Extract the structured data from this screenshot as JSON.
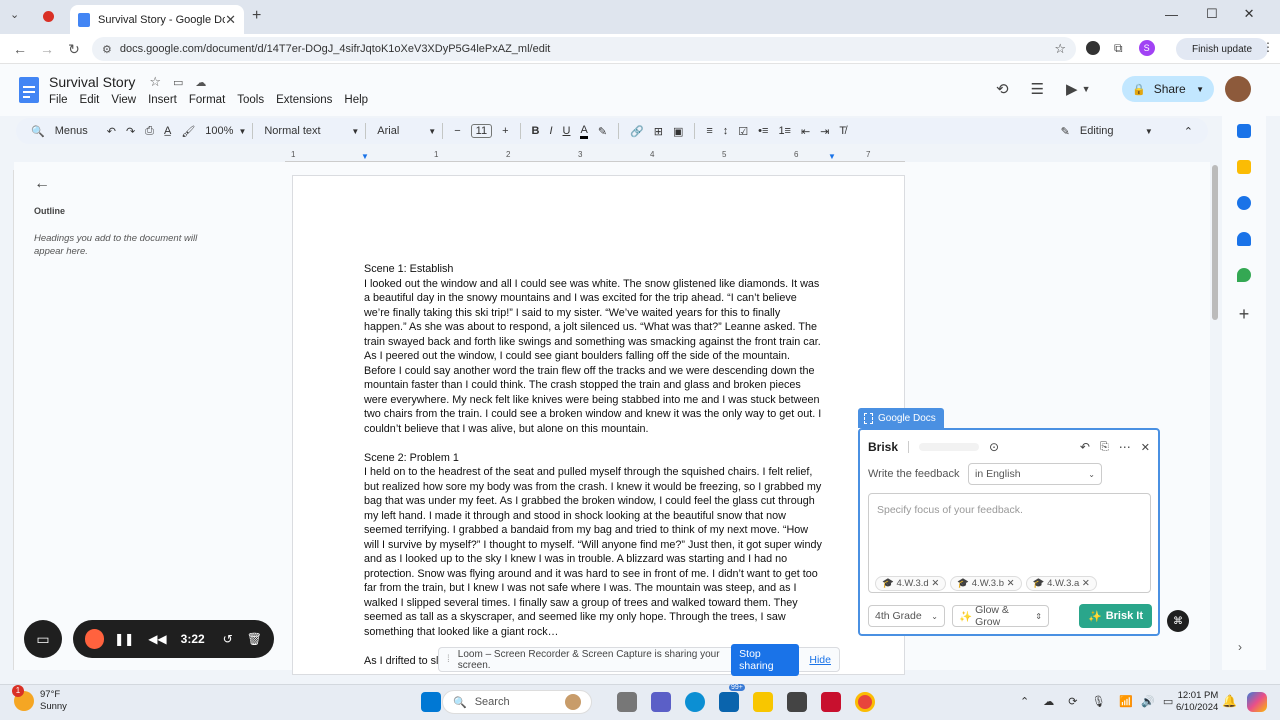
{
  "browser": {
    "tab_title": "Survival Story - Google Docs",
    "url": "docs.google.com/document/d/14T7er-DOgJ_4sifrJqtoK1oXeV3XDyP5G4lePxAZ_ml/edit",
    "finish_update": "Finish update",
    "profile_initial": "S"
  },
  "doc": {
    "title": "Survival Story",
    "menu": [
      "File",
      "Edit",
      "View",
      "Insert",
      "Format",
      "Tools",
      "Extensions",
      "Help"
    ],
    "share_label": "Share"
  },
  "toolbar": {
    "menus": "Menus",
    "zoom": "100%",
    "style": "Normal text",
    "font": "Arial",
    "font_size": "11",
    "mode": "Editing"
  },
  "ruler": [
    "1",
    "1",
    "2",
    "3",
    "4",
    "5",
    "6",
    "7"
  ],
  "outline": {
    "title": "Outline",
    "placeholder": "Headings you add to the document will appear here."
  },
  "content": {
    "lines": [
      "Scene 1: Establish",
      "I looked out the window and all I could see was white. The snow glistened like diamonds. It was",
      "a beautiful day in the snowy mountains and I was excited for the trip ahead. “I can’t believe",
      "we’re finally taking this ski trip!” I said to my sister. “We’ve waited years for this to finally",
      "happen.” As she was about to respond, a jolt silenced us. “What was that?” Leanne asked. The",
      "train swayed back and forth like swings and something was smacking against the front train car.",
      "As I peered out the window, I could see giant boulders falling off the side of the mountain.",
      "Before I could say another word the train flew off the tracks and we were descending down the",
      "mountain faster than I could think. The crash stopped the train and glass and broken pieces",
      "were everywhere. My neck felt like knives were being stabbed into me and I was stuck between",
      "two chairs from the train. I could see a broken window and knew it was the only way to get out. I",
      "couldn’t believe that I was alive, but alone on this mountain.",
      "",
      "Scene 2: Problem 1",
      "I held on to the headrest of the seat and pulled myself through the squished chairs. I felt relief,",
      "but realized how sore my body was from the crash. I knew it would be freezing, so I grabbed my",
      "bag that was under my feet. As I grabbed the broken window, I could feel the glass cut through",
      "my left hand. I made it through and stood in shock looking at the beautiful snow that now",
      "seemed terrifying. I grabbed a bandaid from my bag and tried to think of my next move. “How",
      "will I survive by myself?” I thought to myself. “Will anyone find me?” Just then, it got super windy",
      "and as I looked up to the sky I knew I was in trouble. A blizzard was starting and I had no",
      "protection. Snow was flying around and it was hard to see in front of me. I didn’t want to get too",
      "far from the train, but I knew I was not safe where I was. The mountain was steep, and as I",
      "walked I slipped several times. I finally saw a group of trees and walked toward them. They",
      "seemed as tall as a skyscraper, and seemed like my only hope. Through the trees, I saw",
      "something that looked like a giant rock…",
      "",
      "As I drifted to sl"
    ]
  },
  "brisk": {
    "tab_label": "Google Docs",
    "name": "Brisk",
    "write_label": "Write the feedback",
    "language": "in English",
    "placeholder": "Specify focus of your feedback.",
    "chips": [
      "4.W.3.d",
      "4.W.3.b",
      "4.W.3.a"
    ],
    "grade": "4th Grade",
    "style": "Glow & Grow",
    "button": "Brisk It"
  },
  "loom": {
    "timer": "3:22",
    "share_message": "Loom – Screen Recorder & Screen Capture is sharing your screen.",
    "stop_sharing": "Stop sharing",
    "hide": "Hide"
  },
  "taskbar": {
    "weather_temp": "97°F",
    "weather_desc": "Sunny",
    "weather_badge": "1",
    "search": "Search",
    "mail_badge": "99+",
    "time": "12:01 PM",
    "date": "6/10/2024"
  },
  "colors": {
    "accent": "#1a73e8",
    "share_bg": "#c2e7ff",
    "brisk_border": "#4a90e2",
    "brisk_button": "#2aa68b",
    "loom_record": "#ff623e"
  }
}
